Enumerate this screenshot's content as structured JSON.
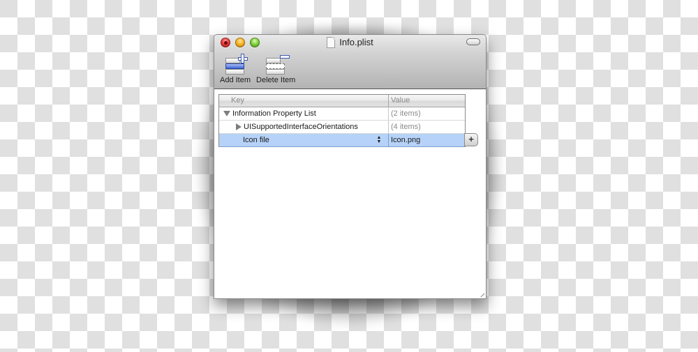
{
  "window": {
    "title": "Info.plist",
    "title_icon": "document-icon"
  },
  "toolbar": {
    "items": [
      {
        "label": "Add Item",
        "icon": "add-item-icon"
      },
      {
        "label": "Delete Item",
        "icon": "delete-item-icon"
      }
    ]
  },
  "table": {
    "columns": [
      "Key",
      "Value"
    ],
    "rows": [
      {
        "key": "Information Property List",
        "value": "(2 items)",
        "disclosure": "expanded",
        "level": 0,
        "selected": false
      },
      {
        "key": "UISupportedInterfaceOrientations",
        "value": "(4 items)",
        "disclosure": "collapsed",
        "level": 1,
        "selected": false
      },
      {
        "key": "Icon file",
        "value": "Icon.png",
        "disclosure": "none",
        "level": 1,
        "selected": true,
        "stepper": "up-down-arrows-icon",
        "add_button": "+"
      }
    ]
  },
  "colors": {
    "selection": "#b6d2f8",
    "accent_blue": "#3f67d6"
  }
}
